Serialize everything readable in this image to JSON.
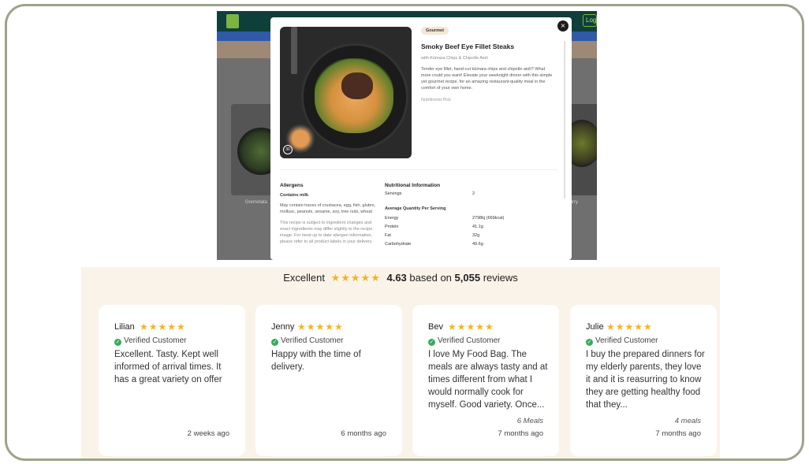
{
  "screenshot": {
    "login_label": "Log",
    "bg_labels": {
      "left": "Gremolata",
      "right": "urry"
    },
    "modal": {
      "close_glyph": "×",
      "photo_badge": "30",
      "tag": "Gourmet",
      "title": "Smoky Beef Eye Fillet Steaks",
      "subtitle": "with Kūmara Chips & Chipotle Aioli",
      "description": "Tender eye fillet, hand-cut kūmara chips and chipotle aioli? What more could you want! Elevate your weeknight dinner with this simple yet gourmet recipe, for an amazing restaurant-quality meal in the comfort of your own home.",
      "nutritionist_pick": "Nutritionist Pick",
      "allergens": {
        "heading": "Allergens",
        "contains": "Contains milk",
        "may_contain": "May contain traces of crustacea, egg, fish, gluten, mollusc, peanuts, sesame, soy, tree nuts, wheat",
        "note": "This recipe is subject to ingredient changes and exact ingredients may differ slightly to the recipe image. For most up to date allergen information, please refer to all product labels in your delivery."
      },
      "nutrition": {
        "heading": "Nutritional Information",
        "servings_label": "Servings",
        "servings_value": "2",
        "avg_heading": "Average Quantity Per Serving",
        "rows": [
          {
            "label": "Energy",
            "value": "2798kj (669kcal)"
          },
          {
            "label": "Protein",
            "value": "41.1g"
          },
          {
            "label": "Fat",
            "value": "32g"
          },
          {
            "label": "Carbohydrate",
            "value": "49.6g"
          }
        ]
      }
    }
  },
  "reviews": {
    "summary": {
      "rating_word": "Excellent",
      "stars": "★★★★★",
      "score": "4.63",
      "based_on": "based on",
      "count": "5,055",
      "reviews_word": "reviews"
    },
    "verified_label": "Verified Customer",
    "check_glyph": "✓",
    "items": [
      {
        "name": "Lilian",
        "stars": "★★★★★",
        "text": "Excellent. Tasty. Kept well informed of arrival times. It has a great variety on offer",
        "meals": "",
        "ago": "2 weeks ago"
      },
      {
        "name": "Jenny",
        "stars": "★★★★★",
        "text": "Happy with the time of delivery.",
        "meals": "",
        "ago": "6 months ago"
      },
      {
        "name": "Bev",
        "stars": "★★★★★",
        "text": "I love My Food Bag. The meals are always tasty and at times different from what I would normally cook for myself. Good variety. Once...",
        "meals": "6 Meals",
        "ago": "7 months ago"
      },
      {
        "name": "Julie",
        "stars": "★★★★★",
        "text": "I buy the prepared dinners for my elderly parents, they love it and it is reasurring to know they are getting healthy food that they...",
        "meals": "4 meals",
        "ago": "7 months ago"
      }
    ]
  },
  "colors": {
    "star": "#f5b324",
    "verified_check": "#2fae5b",
    "reviews_bg": "#faf3ea",
    "frame_border": "#9ca38a",
    "nav_bg": "#0f3f3a"
  }
}
